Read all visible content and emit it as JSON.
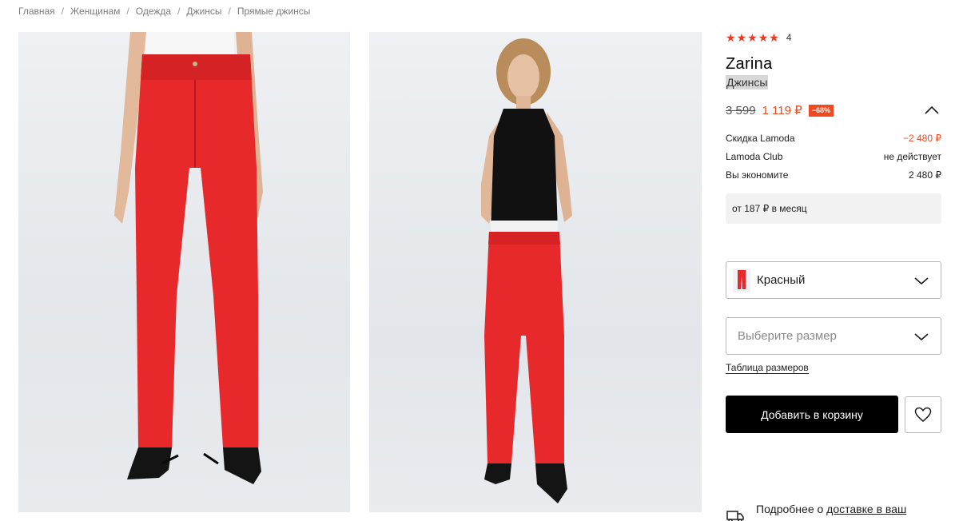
{
  "breadcrumb": [
    "Главная",
    "Женщинам",
    "Одежда",
    "Джинсы",
    "Прямые джинсы"
  ],
  "breadcrumb_separator": "/",
  "product": {
    "rating_value": 5,
    "rating_max": 5,
    "reviews_count": "4",
    "brand": "Zarina",
    "type": "Джинсы",
    "old_price": "3 599",
    "new_price": "1 119 ₽",
    "discount": "−68%",
    "color_garment": "#e8292b"
  },
  "price_breakdown": [
    {
      "label": "Скидка Lamoda",
      "value": "−2 480 ₽",
      "highlight": true
    },
    {
      "label": "Lamoda Club",
      "value": "не действует",
      "highlight": false
    },
    {
      "label": "Вы экономите",
      "value": "2 480 ₽",
      "highlight": false
    }
  ],
  "installment": "от 187 ₽ в месяц",
  "color_select": {
    "value": "Красный"
  },
  "size_select": {
    "placeholder": "Выберите размер"
  },
  "size_table_link": "Таблица размеров",
  "cart_button": "Добавить в корзину",
  "delivery": {
    "prefix": "Подробнее о ",
    "link": "доставке в ваш"
  },
  "icons": {
    "star": "star-icon",
    "collapse": "chevron-up-icon",
    "dropdown": "chevron-down-icon",
    "favorite": "heart-icon",
    "delivery": "truck-icon"
  },
  "colors": {
    "accent": "#f04a22",
    "star": "#ef3724",
    "primary_button": "#000000"
  }
}
